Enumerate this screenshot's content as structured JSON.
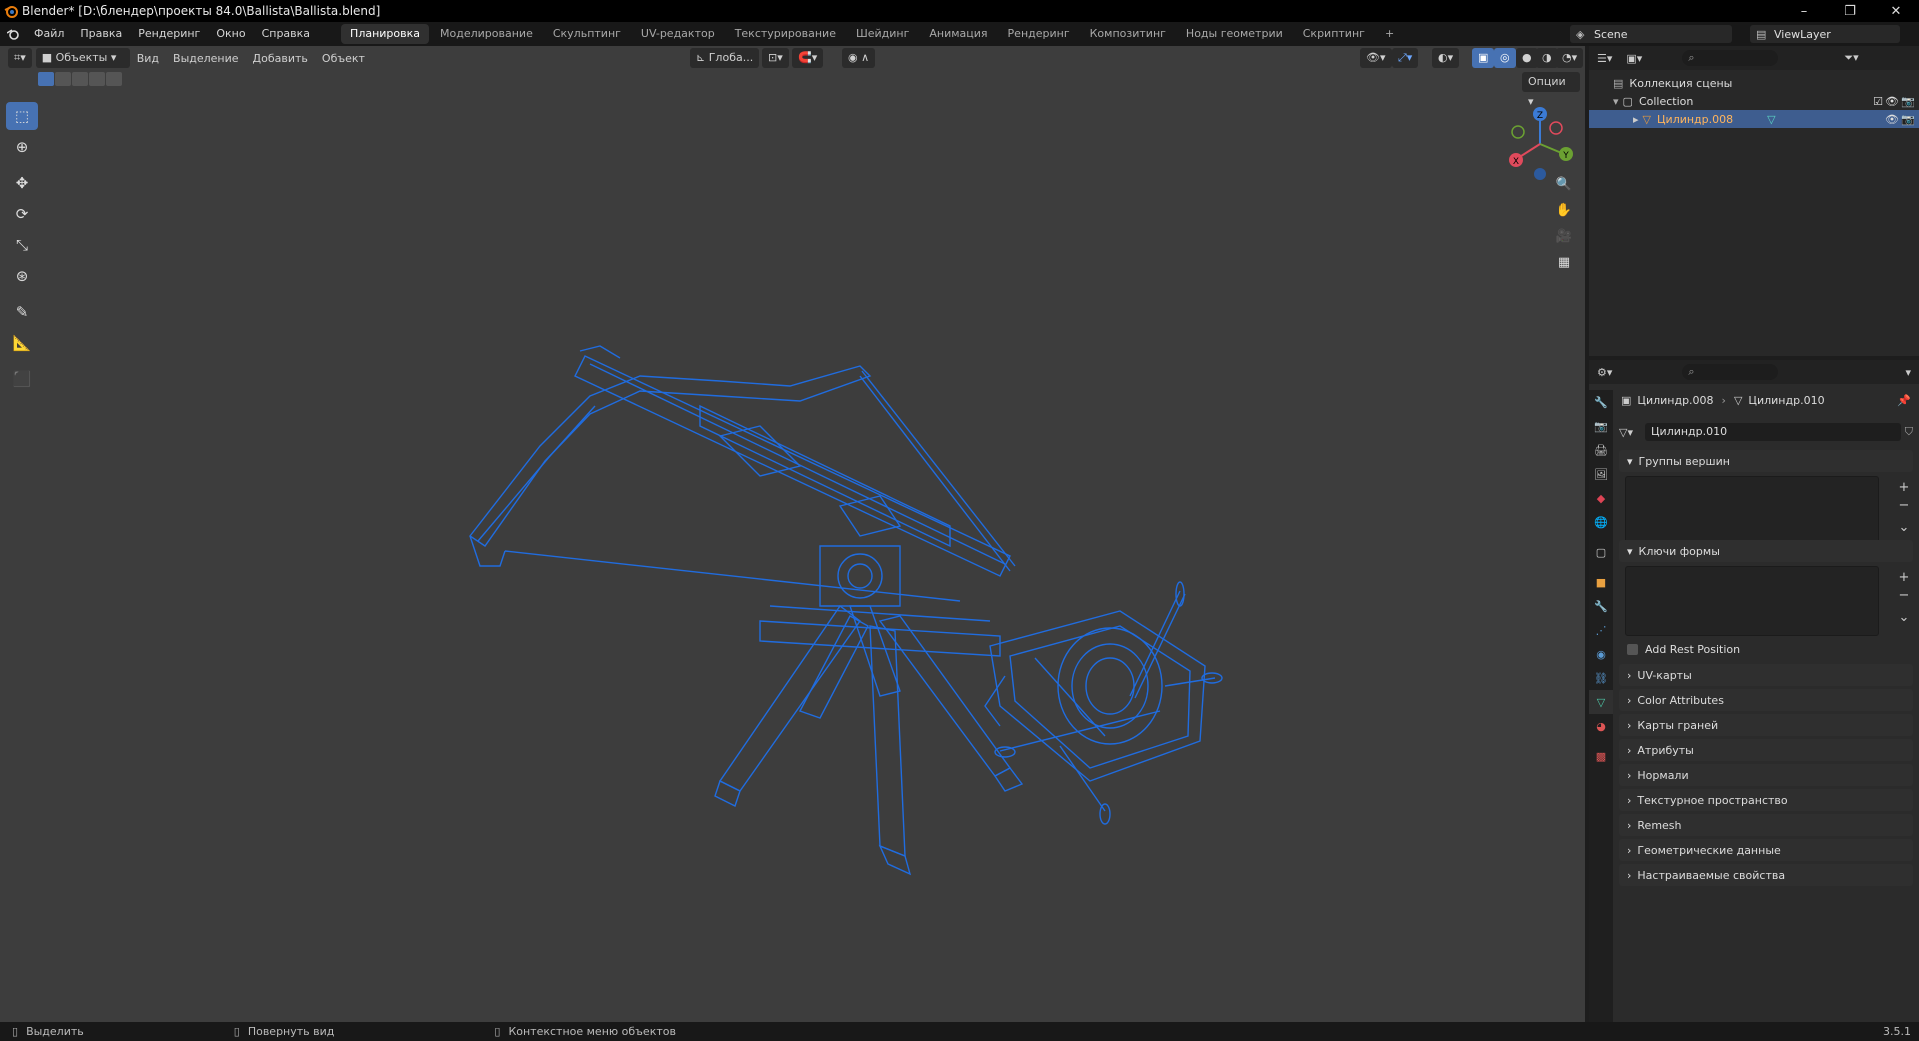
{
  "window": {
    "title": "Blender* [D:\\блендер\\проекты 84.0\\Ballista\\Ballista.blend]"
  },
  "menu": [
    "Файл",
    "Правка",
    "Рендеринг",
    "Окно",
    "Справка"
  ],
  "workspaces": [
    "Планировка",
    "Моделирование",
    "Скульптинг",
    "UV-редактор",
    "Текстурирование",
    "Шейдинг",
    "Анимация",
    "Рендеринг",
    "Композитинг",
    "Ноды геометрии",
    "Скриптинг"
  ],
  "workspace_add": "+",
  "scene": {
    "name": "Scene",
    "view_layer": "ViewLayer"
  },
  "viewport": {
    "mode": "Объекты",
    "menus": [
      "Вид",
      "Выделение",
      "Добавить",
      "Объект"
    ],
    "orientation": "Глоба...",
    "options_label": "Опции",
    "gizmo_axes": {
      "x": "X",
      "y": "Y",
      "z": "Z"
    },
    "wire_color": "#1f6fe8"
  },
  "outliner": {
    "root": "Коллекция сцены",
    "collection": "Collection",
    "object": "Цилиндр.008"
  },
  "properties": {
    "breadcrumb_object": "Цилиндр.008",
    "breadcrumb_data": "Цилиндр.010",
    "mesh_name": "Цилиндр.010",
    "panels_open": [
      "Группы вершин",
      "Ключи формы"
    ],
    "add_rest_position": "Add Rest Position",
    "panels_closed": [
      "UV-карты",
      "Color Attributes",
      "Карты граней",
      "Атрибуты",
      "Нормали",
      "Текстурное пространство",
      "Remesh",
      "Геометрические данные",
      "Настраиваемые свойства"
    ]
  },
  "status": {
    "select": "Выделить",
    "rotate": "Повернуть вид",
    "context": "Контекстное меню объектов",
    "version": "3.5.1"
  }
}
